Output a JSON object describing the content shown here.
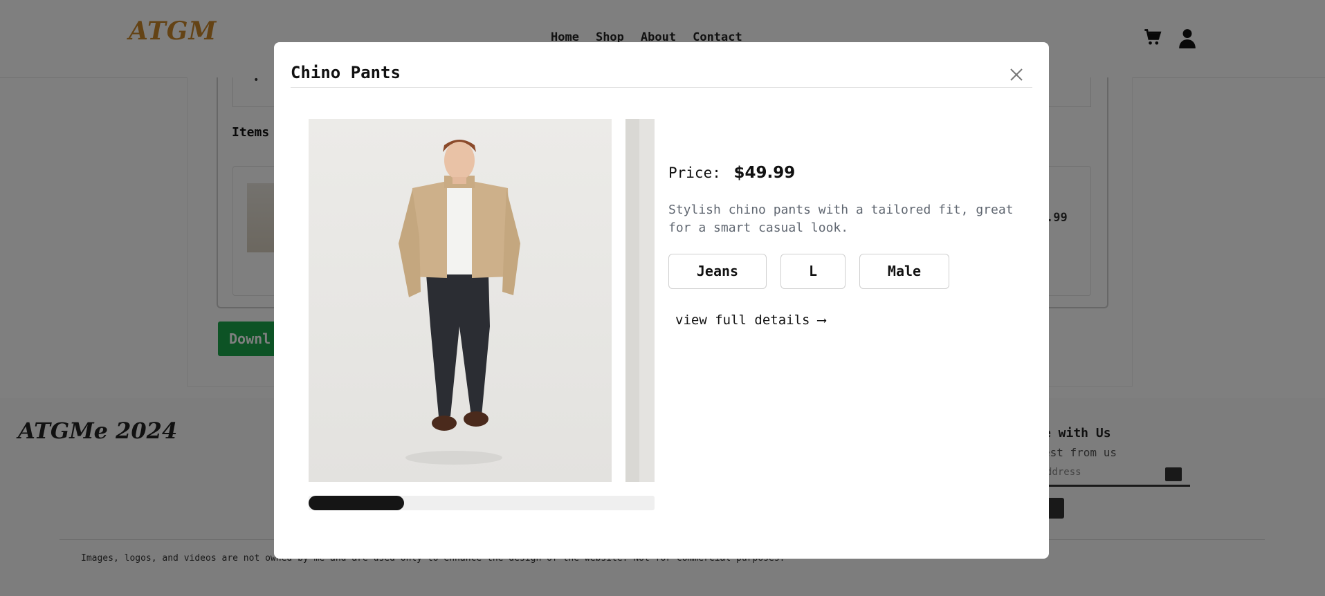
{
  "header": {
    "logo": "ATGM",
    "nav": [
      "Home",
      "Shop",
      "About",
      "Contact"
    ],
    "icons": [
      "cart-icon",
      "user-icon"
    ]
  },
  "background": {
    "order_item": "• ",
    "items_title": "Items",
    "item_price": ".99",
    "download_button": "Downl"
  },
  "footer": {
    "logo": "ATGMe 2024",
    "connect_title": "e with Us",
    "connect_sub": "est from us",
    "email_placeholder": "ddress",
    "disclaimer": "Images, logos, and videos are not owned by me and are used only to enhance the design of the website. Not for commercial purposes."
  },
  "modal": {
    "title": "Chino Pants",
    "close_icon": "close-icon",
    "price_label": "Price:",
    "price": "$49.99",
    "description": "Stylish chino pants with a tailored fit, great for a smart casual look.",
    "tags": [
      "Jeans",
      "L",
      "Male"
    ],
    "details_link": "view full details ⟶",
    "gallery": {
      "image_count": 2,
      "scroll_position_fraction": 0.28
    }
  }
}
